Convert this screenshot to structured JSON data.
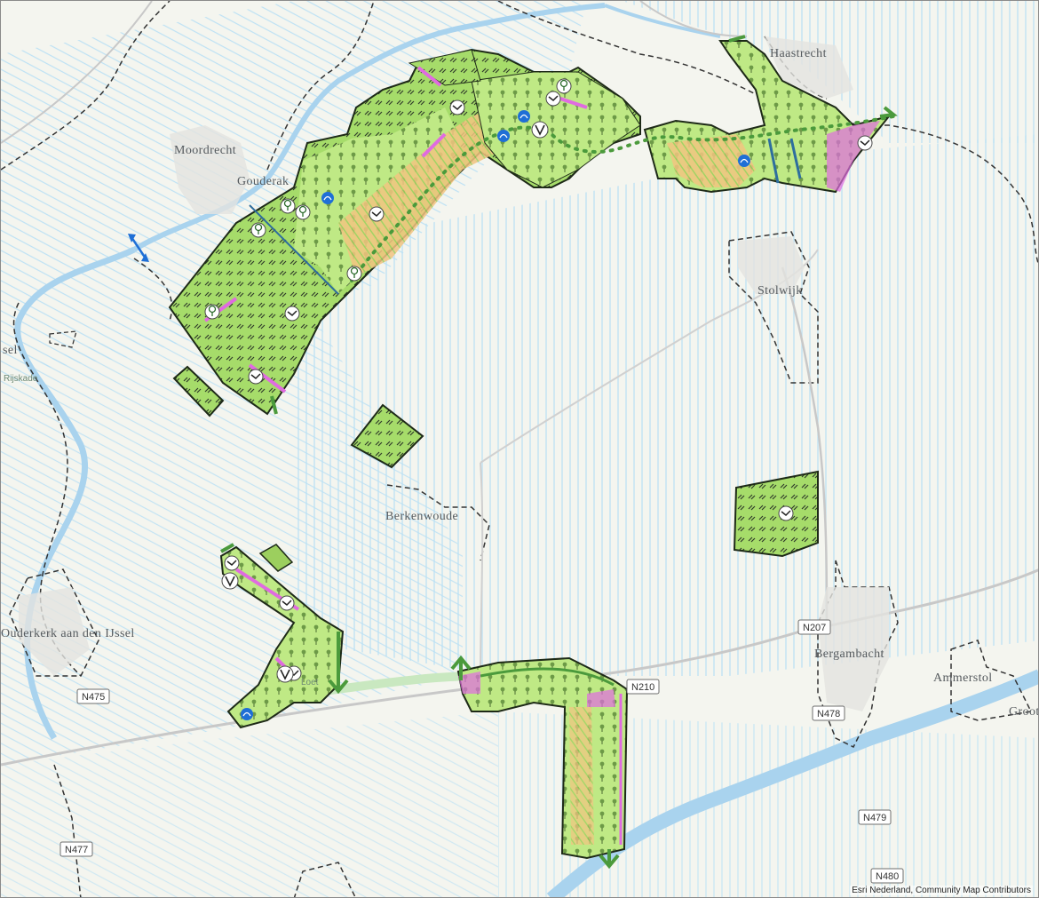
{
  "places": {
    "moordrecht": "Moordrecht",
    "gouderak": "Gouderak",
    "haastrecht": "Haastrecht",
    "stolwijk": "Stolwijk",
    "berkenwoude": "Berkenwoude",
    "ouderkerk": "Ouderkerk aan den IJssel",
    "bergambacht": "Bergambacht",
    "ammerstol": "Ammerstol",
    "groot": "Groot",
    "ijssel_west": "sel",
    "rijskade": "Rijskade",
    "loetbroek": "Loet"
  },
  "roads": {
    "n207": "N207",
    "n210": "N210",
    "n478": "N478",
    "n479": "N479",
    "n480": "N480",
    "n475": "N475",
    "n477": "N477"
  },
  "attribution": "Esri Nederland, Community Map Contributors",
  "colors": {
    "water": "#a9d3ee",
    "land": "#f4f5ef",
    "area_fill": "#b9e67a",
    "area_dark": "#7cc444",
    "hatch": "#2f3a2a",
    "orange": "#f2c480",
    "pink": "#e06be0",
    "route": "#4b9a3c"
  }
}
